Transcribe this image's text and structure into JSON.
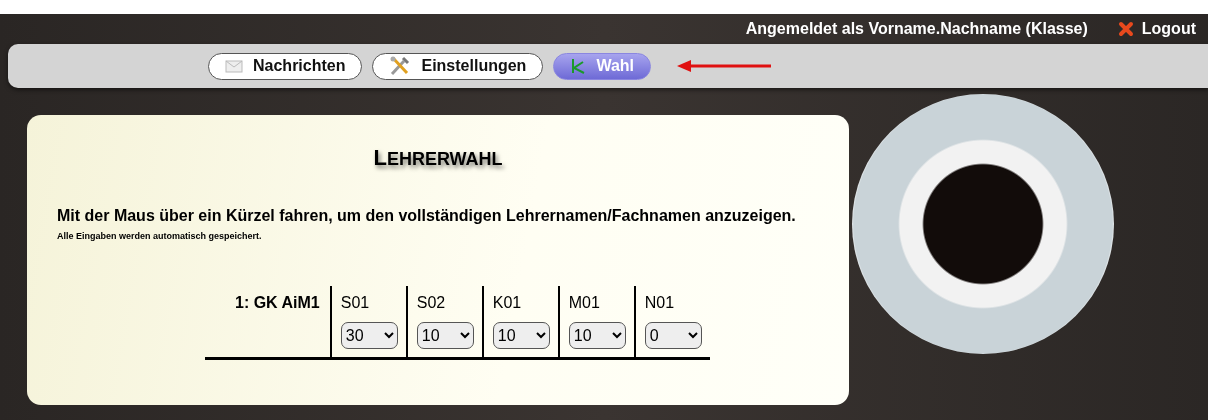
{
  "header": {
    "user_text": "Angemeldet als Vorname.Nachname (Klasse)",
    "logout": "Logout"
  },
  "tabs": [
    {
      "label": "Nachrichten",
      "selected": false
    },
    {
      "label": "Einstellungen",
      "selected": false
    },
    {
      "label": "Wahl",
      "selected": true
    }
  ],
  "card": {
    "title": "LEHRERWAHL",
    "instruction": "Mit der Maus über ein Kürzel fahren, um den vollständigen Lehrernamen/Fachnamen anzuzeigen.",
    "note": "Alle Eingaben werden automatisch gespeichert.",
    "course": "1: GK AiM1",
    "teachers": [
      {
        "code": "S01",
        "value": "30"
      },
      {
        "code": "S02",
        "value": "10"
      },
      {
        "code": "K01",
        "value": "10"
      },
      {
        "code": "M01",
        "value": "10"
      },
      {
        "code": "N01",
        "value": "0"
      }
    ]
  }
}
